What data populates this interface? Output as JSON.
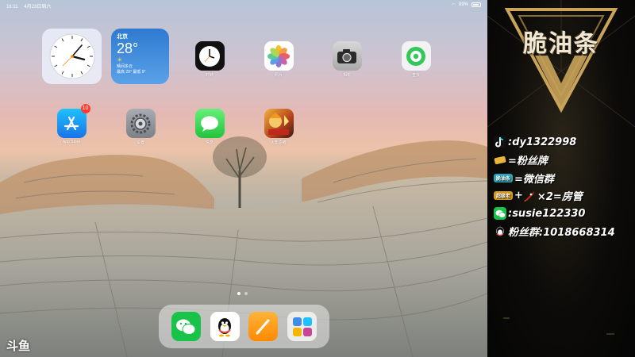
{
  "status_bar": {
    "time": "16:11",
    "date": "4月23日周六",
    "battery": "89%"
  },
  "widgets": {
    "weather": {
      "city": "北京",
      "temp": "28°",
      "condition": "晴间多云",
      "range": "最高 29° 最低 9°"
    }
  },
  "apps": [
    {
      "label": "时钟"
    },
    {
      "label": "照片"
    },
    {
      "label": "相机"
    },
    {
      "label": "查找"
    },
    {
      "label": "App Store",
      "badge": "10"
    },
    {
      "label": "设置"
    },
    {
      "label": "信息"
    },
    {
      "label": "火影忍者"
    }
  ],
  "dock": [
    "微信",
    "QQ",
    "Pages",
    "App Library"
  ],
  "watermark": "斗鱼",
  "overlay": {
    "brand": "脆油条",
    "rows": [
      {
        "text": ":dy1322998"
      },
      {
        "text": "=粉丝牌"
      },
      {
        "pill": "脆油条",
        "text": "=微信群"
      },
      {
        "pill": "超级老",
        "prefix": "+",
        "text": "×2=房管"
      },
      {
        "text": ":susie122330"
      },
      {
        "text": "粉丝群:1018668314"
      }
    ]
  },
  "colors": {
    "accent_gold": "#c9a35a",
    "badge_red": "#ff3b30",
    "wechat_green": "#19c34a"
  }
}
